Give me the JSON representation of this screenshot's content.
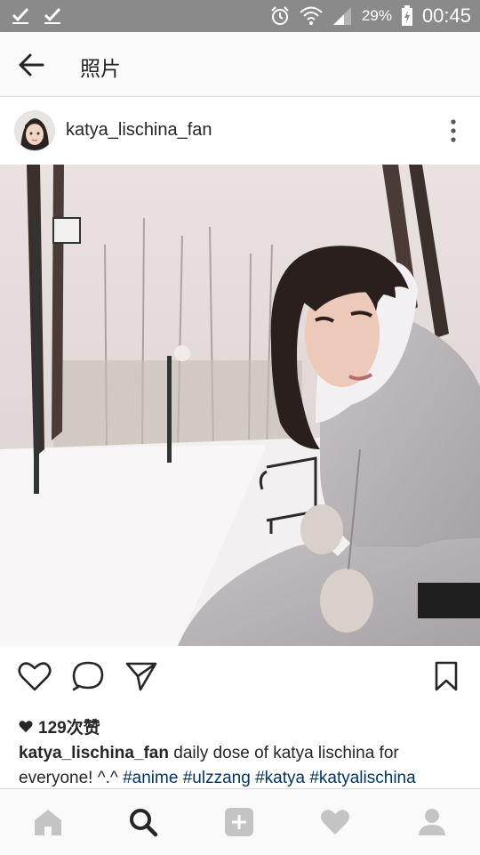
{
  "status_bar": {
    "battery_percent": "29%",
    "time": "00:45",
    "icons": [
      "check-icon",
      "check-icon",
      "alarm-icon",
      "wifi-icon",
      "signal-icon",
      "battery-charging-icon"
    ]
  },
  "top_bar": {
    "title": "照片",
    "back_icon": "arrow-left-icon"
  },
  "post": {
    "username": "katya_lischina_fan",
    "more_icon": "more-vertical-icon",
    "likes": "129次赞",
    "caption": {
      "username": "katya_lischina_fan",
      "text": " daily dose of katya lischina for everyone! ^.^ ",
      "hashtags": [
        "#anime",
        "#ulzzang",
        "#katya",
        "#katyalischina"
      ]
    }
  },
  "actions": [
    "heart-icon",
    "comment-icon",
    "share-icon",
    "bookmark-icon"
  ],
  "bottom_nav": [
    "home-icon",
    "search-icon",
    "add-icon",
    "activity-heart-icon",
    "profile-icon"
  ],
  "colors": {
    "status_bar": "#8a8a8a",
    "hashtag": "#003569",
    "nav_inactive": "#c4c4c4",
    "nav_active": "#262626"
  }
}
